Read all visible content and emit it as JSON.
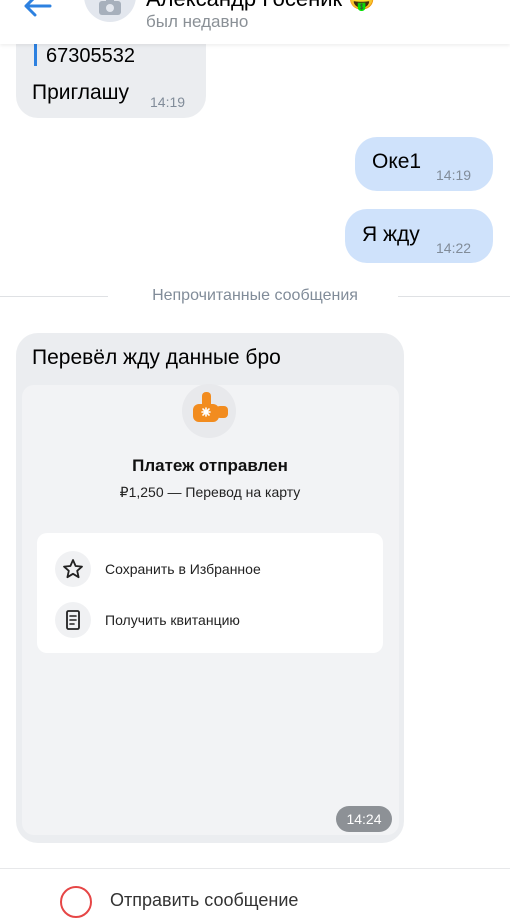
{
  "header": {
    "title": "Александр Госеник 🤑",
    "status": "был недавно",
    "back_icon": "back-arrow-icon",
    "avatar_icon": "camera-icon"
  },
  "messages": {
    "m1": {
      "quote": "67305532",
      "text": "Приглашу",
      "time": "14:19"
    },
    "m2": {
      "text": "Оке1",
      "time": "14:19"
    },
    "m3": {
      "text": "Я жду",
      "time": "14:22"
    }
  },
  "divider": "Непрочитанные сообщения",
  "transfer": {
    "message": "Перевёл жду данные бро",
    "icon": "thumbs-up-icon",
    "title": "Платеж отправлен",
    "subtitle": "₽1,250 — Перевод на карту",
    "actions": [
      {
        "label": "Сохранить в Избранное",
        "icon": "star-icon"
      },
      {
        "label": "Получить квитанцию",
        "icon": "receipt-icon"
      }
    ],
    "time": "14:24"
  },
  "bottom": {
    "text": "Отправить сообщение",
    "icon": "alert-icon"
  },
  "colors": {
    "accent": "#2d81e0",
    "incoming": "#ebedf0",
    "outgoing": "#cfe2fb",
    "alert": "#e64646"
  }
}
